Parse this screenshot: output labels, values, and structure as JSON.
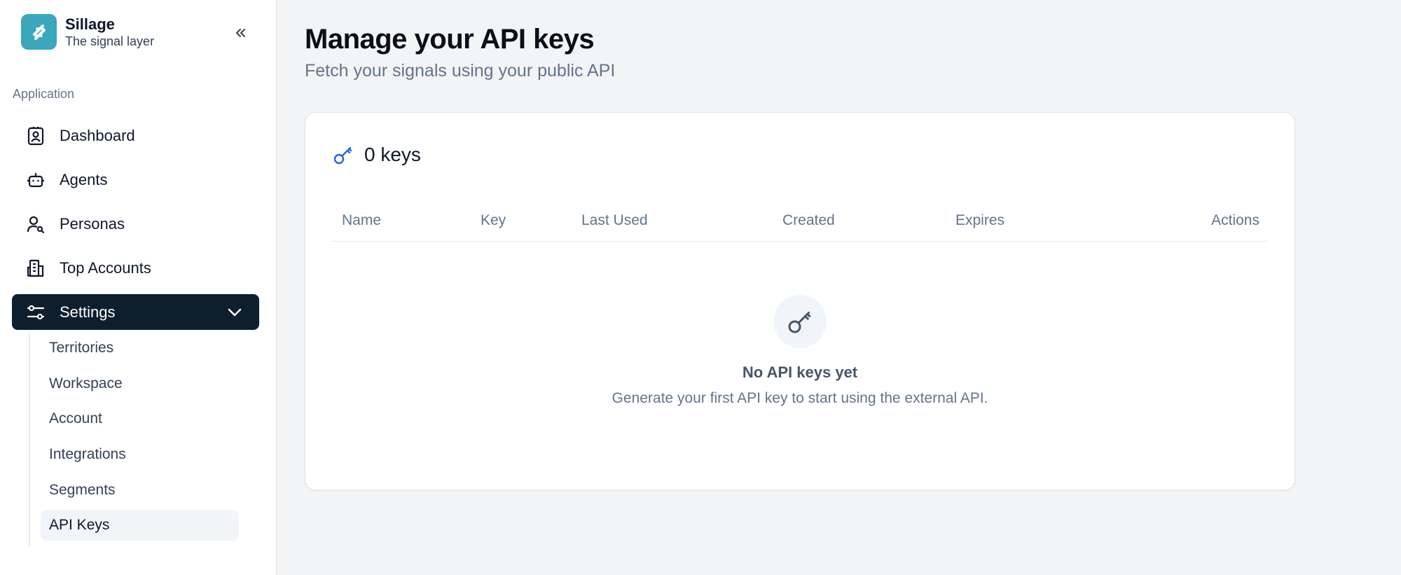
{
  "brand": {
    "name": "Sillage",
    "tagline": "The signal layer"
  },
  "sidebar": {
    "section_label": "Application",
    "items": [
      {
        "label": "Dashboard",
        "icon": "dashboard-icon"
      },
      {
        "label": "Agents",
        "icon": "robot-icon"
      },
      {
        "label": "Personas",
        "icon": "user-search-icon"
      },
      {
        "label": "Top Accounts",
        "icon": "building-icon"
      },
      {
        "label": "Settings",
        "icon": "sliders-icon",
        "active": true,
        "expanded": true
      }
    ],
    "settings_subitems": [
      {
        "label": "Territories"
      },
      {
        "label": "Workspace"
      },
      {
        "label": "Account"
      },
      {
        "label": "Integrations"
      },
      {
        "label": "Segments"
      },
      {
        "label": "API Keys",
        "active": true
      }
    ]
  },
  "page": {
    "title": "Manage your API keys",
    "subtitle": "Fetch your signals using your public API"
  },
  "card": {
    "count_label": "0 keys",
    "columns": [
      "Name",
      "Key",
      "Last Used",
      "Created",
      "Expires",
      "Actions"
    ],
    "empty_title": "No API keys yet",
    "empty_description": "Generate your first API key to start using the external API."
  },
  "colors": {
    "brand": "#3aa7bd",
    "active_nav": "#0d1f2d",
    "key_accent": "#2563eb"
  }
}
